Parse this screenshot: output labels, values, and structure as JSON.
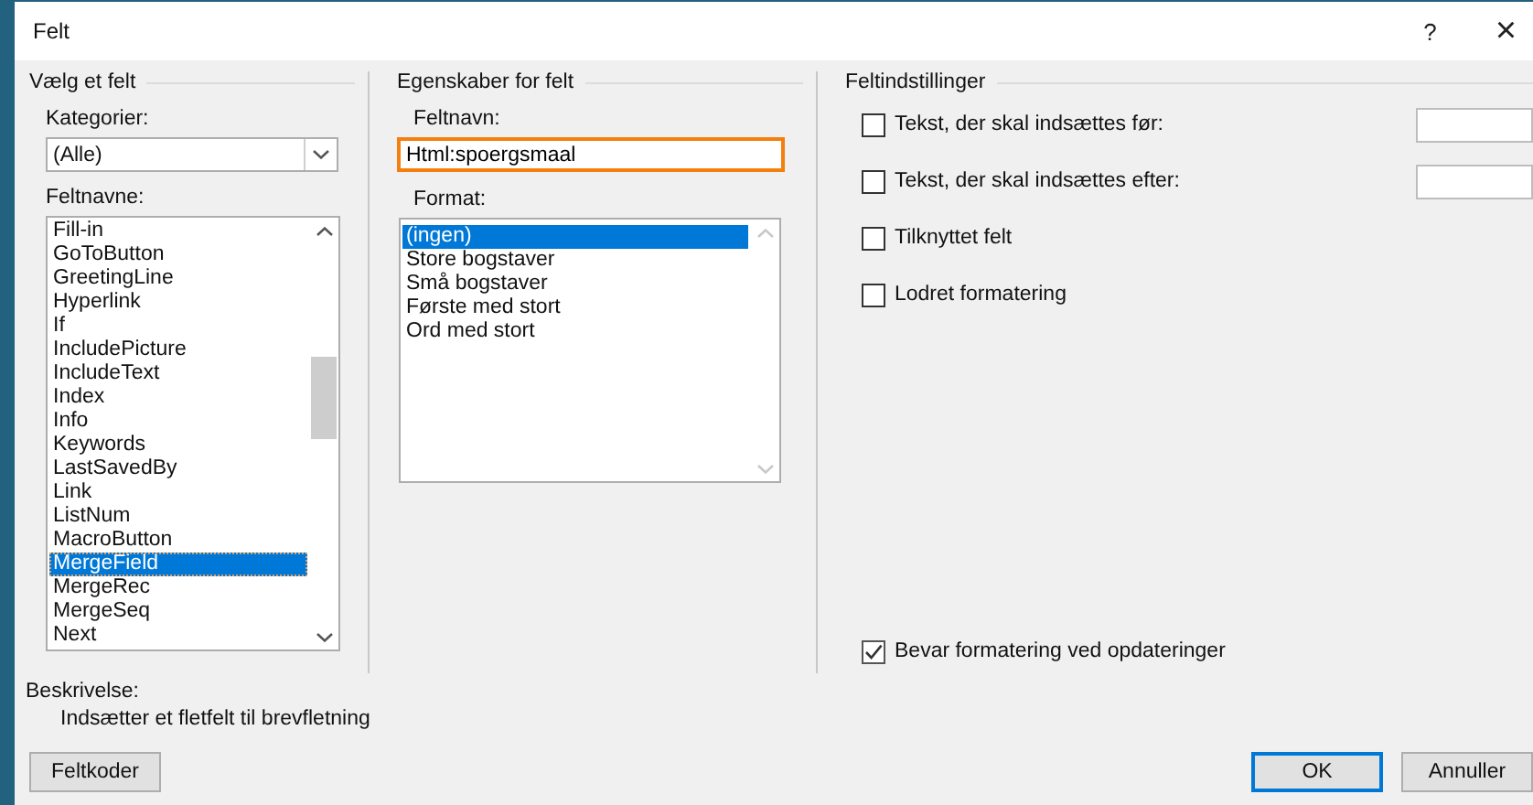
{
  "window": {
    "title": "Felt",
    "help_button": "?",
    "close_button": "×"
  },
  "choose_field": {
    "title": "Vælg et felt",
    "categories_label": "Kategorier:",
    "categories_value": "(Alle)",
    "field_names_label": "Feltnavne:",
    "field_names": [
      {
        "label": "Fill-in",
        "selected": false
      },
      {
        "label": "GoToButton",
        "selected": false
      },
      {
        "label": "GreetingLine",
        "selected": false
      },
      {
        "label": "Hyperlink",
        "selected": false
      },
      {
        "label": "If",
        "selected": false
      },
      {
        "label": "IncludePicture",
        "selected": false
      },
      {
        "label": "IncludeText",
        "selected": false
      },
      {
        "label": "Index",
        "selected": false
      },
      {
        "label": "Info",
        "selected": false
      },
      {
        "label": "Keywords",
        "selected": false
      },
      {
        "label": "LastSavedBy",
        "selected": false
      },
      {
        "label": "Link",
        "selected": false
      },
      {
        "label": "ListNum",
        "selected": false
      },
      {
        "label": "MacroButton",
        "selected": false
      },
      {
        "label": "MergeField",
        "selected": true
      },
      {
        "label": "MergeRec",
        "selected": false
      },
      {
        "label": "MergeSeq",
        "selected": false
      },
      {
        "label": "Next",
        "selected": false
      }
    ]
  },
  "field_properties": {
    "title": "Egenskaber for felt",
    "field_name_label": "Feltnavn:",
    "field_name_value": "Html:spoergsmaal",
    "field_name_focused": true,
    "format_label": "Format:",
    "formats": [
      {
        "label": "(ingen)",
        "selected": true
      },
      {
        "label": "Store bogstaver",
        "selected": false
      },
      {
        "label": "Små bogstaver",
        "selected": false
      },
      {
        "label": "Første med stort",
        "selected": false
      },
      {
        "label": "Ord med stort",
        "selected": false
      }
    ]
  },
  "field_options": {
    "title": "Feltindstillinger",
    "options": [
      {
        "label": "Tekst, der skal indsættes før:",
        "checked": false,
        "kind": "text"
      },
      {
        "label": "Tekst, der skal indsættes efter:",
        "checked": false,
        "kind": "text"
      },
      {
        "label": "Tilknyttet felt",
        "checked": false,
        "kind": "plain"
      },
      {
        "label": "Lodret formatering",
        "checked": false,
        "kind": "plain"
      }
    ],
    "preserve": {
      "label": "Bevar formatering ved opdateringer",
      "checked": true
    }
  },
  "description": {
    "label": "Beskrivelse:",
    "text": "Indsætter et fletfelt til brevfletning"
  },
  "buttons": [
    {
      "label": "Feltkoder",
      "default": false
    },
    {
      "label": "OK",
      "default": true
    },
    {
      "label": "Annuller",
      "default": false
    }
  ]
}
